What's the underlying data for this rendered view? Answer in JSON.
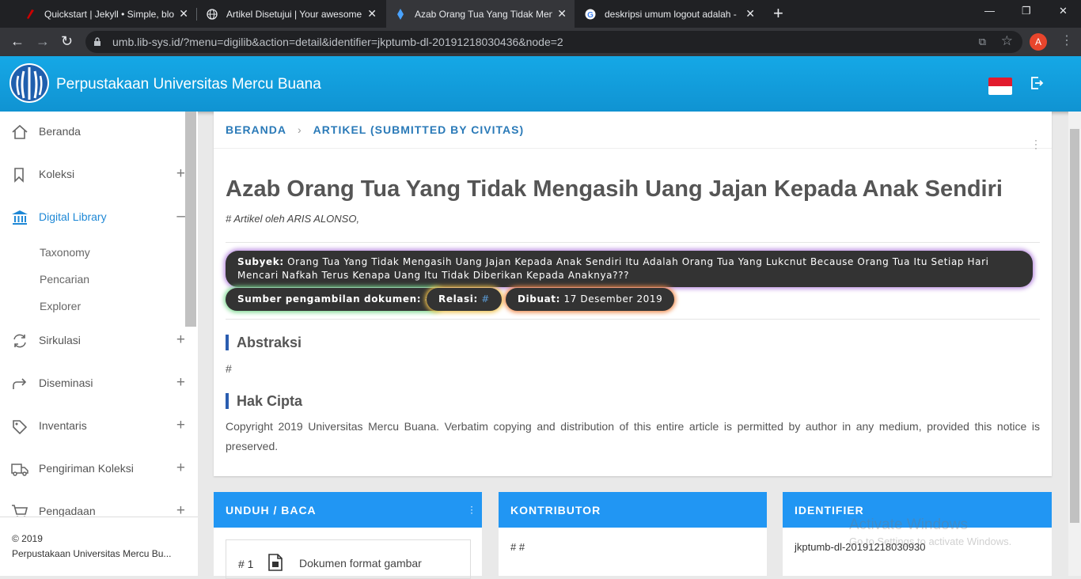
{
  "browser": {
    "tabs": [
      {
        "title": "Quickstart | Jekyll • Simple, blog-"
      },
      {
        "title": "Artikel Disetujui | Your awesome"
      },
      {
        "title": "Azab Orang Tua Yang Tidak Men"
      },
      {
        "title": "deskripsi umum logout adalah -"
      }
    ],
    "url": "umb.lib-sys.id/?menu=digilib&action=detail&identifier=jkptumb-dl-20191218030436&node=2",
    "profile_initial": "A"
  },
  "app": {
    "title": "Perpustakaan Universitas Mercu Buana"
  },
  "sidebar": {
    "items": [
      {
        "label": "Beranda"
      },
      {
        "label": "Koleksi",
        "toggle": "+"
      },
      {
        "label": "Digital Library",
        "toggle": "–"
      },
      {
        "label": "Sirkulasi",
        "toggle": "+"
      },
      {
        "label": "Diseminasi",
        "toggle": "+"
      },
      {
        "label": "Inventaris",
        "toggle": "+"
      },
      {
        "label": "Pengiriman Koleksi",
        "toggle": "+"
      },
      {
        "label": "Pengadaan",
        "toggle": "+"
      }
    ],
    "subitems": [
      "Taxonomy",
      "Pencarian",
      "Explorer"
    ],
    "footer": {
      "copyright": "© 2019",
      "name": "Perpustakaan Universitas Mercu Bu..."
    }
  },
  "breadcrumb": {
    "home": "BERANDA",
    "current": "ARTIKEL (SUBMITTED BY CIVITAS)"
  },
  "article": {
    "title": "Azab Orang Tua Yang Tidak Mengasih Uang Jajan Kepada Anak Sendiri",
    "byline": "# Artikel oleh ARIS ALONSO,",
    "subyek_label": "Subyek:",
    "subyek_value": "Orang Tua Yang Tidak Mengasih Uang Jajan Kepada Anak Sendiri Itu Adalah Orang Tua Yang Lukcnut Because Orang Tua Itu Setiap Hari Mencari Nafkah Terus Kenapa Uang Itu Tidak Diberikan Kepada Anaknya???",
    "sumber_label": "Sumber pengambilan dokumen:",
    "sumber_value": "#",
    "relasi_label": "Relasi:",
    "relasi_value": "#",
    "dibuat_label": "Dibuat:",
    "dibuat_value": "17 Desember 2019",
    "abstraksi_heading": "Abstraksi",
    "abstraksi_body": "#",
    "hakcipta_heading": "Hak Cipta",
    "hakcipta_body": "Copyright 2019 Universitas Mercu Buana. Verbatim copying and distribution of this entire article is permitted by author in any medium, provided this notice is preserved."
  },
  "unduh": {
    "heading": "UNDUH / BACA",
    "number": "# 1",
    "doc_label": "Dokumen format gambar"
  },
  "kontributor": {
    "heading": "KONTRIBUTOR",
    "body": "# #"
  },
  "identifier": {
    "heading": "IDENTIFIER",
    "body": "jkptumb-dl-20191218030930"
  },
  "watermark": {
    "line1": "Activate Windows",
    "line2": "Go to Settings to activate Windows."
  },
  "colors": {
    "header": "#1093d2",
    "accent": "#2196f3",
    "pill_bg": "#333333"
  }
}
